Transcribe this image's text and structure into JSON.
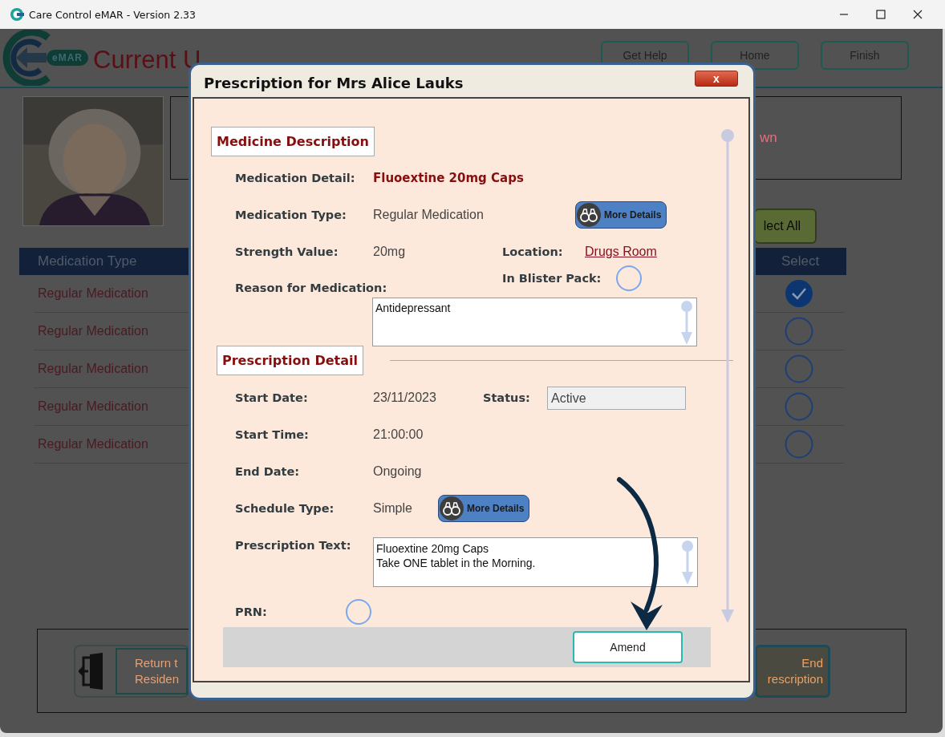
{
  "window": {
    "title": "Care Control eMAR - Version 2.33"
  },
  "header": {
    "logo_badge": "eMAR",
    "current_user": "Current U",
    "buttons": [
      "Get Help",
      "Home",
      "Finish"
    ]
  },
  "resident_info": {
    "text": "wn"
  },
  "select_all": {
    "label": "lect All"
  },
  "table": {
    "columns": [
      "Medication Type",
      "Select"
    ],
    "rows": [
      {
        "medication_type": "Regular Medication",
        "selected": true
      },
      {
        "medication_type": "Regular Medication",
        "selected": false
      },
      {
        "medication_type": "Regular Medication",
        "selected": false
      },
      {
        "medication_type": "Regular Medication",
        "selected": false
      },
      {
        "medication_type": "Regular Medication",
        "selected": false
      }
    ]
  },
  "footer_buttons": [
    {
      "kind": "exit",
      "lines": [
        "Return t",
        "Residen"
      ]
    },
    {
      "kind": "plain",
      "lines": [
        "End",
        "rescription"
      ]
    }
  ],
  "dialog": {
    "title": "Prescription for Mrs Alice Lauks",
    "close": "x",
    "medicine_description": {
      "heading": "Medicine Description",
      "medication_detail": {
        "label": "Medication Detail:",
        "value": "Fluoextine 20mg Caps"
      },
      "medication_type": {
        "label": "Medication Type:",
        "value": "Regular Medication",
        "button": "More Details"
      },
      "strength": {
        "label": "Strength Value:",
        "value": "20mg"
      },
      "location": {
        "label": "Location:",
        "value": "Drugs Room"
      },
      "blister_pack": {
        "label": "In Blister Pack:",
        "checked": false
      },
      "reason": {
        "label": "Reason for Medication:",
        "value": "Antidepressant"
      }
    },
    "prescription_detail": {
      "heading": "Prescription Detail",
      "start_date": {
        "label": "Start Date:",
        "value": "23/11/2023"
      },
      "status": {
        "label": "Status:",
        "value": "Active"
      },
      "start_time": {
        "label": "Start Time:",
        "value": "21:00:00"
      },
      "end_date": {
        "label": "End Date:",
        "value": "Ongoing"
      },
      "schedule_type": {
        "label": "Schedule Type:",
        "value": "Simple",
        "button": "More Details"
      },
      "prescription_text": {
        "label": "Prescription Text:",
        "lines": [
          "Fluoextine 20mg Caps",
          "Take ONE tablet in the Morning."
        ]
      },
      "prn": {
        "label": "PRN:",
        "checked": false
      }
    },
    "amend_button": "Amend"
  }
}
